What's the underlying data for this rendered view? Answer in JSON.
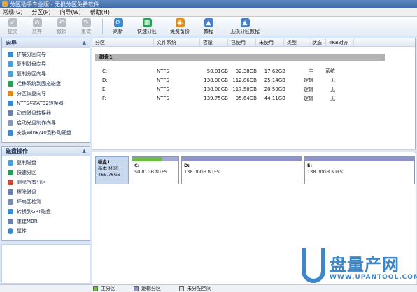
{
  "window": {
    "title": "分区助手专业版 - 无损分区免费软件"
  },
  "menu": [
    "常规(G)",
    "分区(P)",
    "向导(W)",
    "帮助(H)"
  ],
  "toolbar": {
    "commit": "提交",
    "discard": "放弃",
    "undo": "撤销",
    "redo": "重做",
    "refresh": "刷新",
    "quick_partition": "快速分区",
    "free_backup": "免费备份",
    "tutorial": "教程",
    "lossless_tutorial": "无损分区教程"
  },
  "wizard_panel": {
    "title": "向导",
    "items": [
      "扩展分区向导",
      "复制磁盘向导",
      "复制分区向导",
      "迁移系统到固态磁盘",
      "分区恢复向导",
      "NTFS与FAT32转换器",
      "动态磁盘转换器",
      "启动光盘制作向导",
      "安装Win8/10到移动硬盘"
    ]
  },
  "disk_ops_panel": {
    "title": "磁盘操作",
    "items": [
      "复制磁盘",
      "快速分区",
      "删除所有分区",
      "擦除磁盘",
      "坏扇区检测",
      "转换到GPT磁盘",
      "重建MBR",
      "属性"
    ]
  },
  "grid": {
    "columns": [
      "分区",
      "文件系统",
      "容量",
      "已使用",
      "未使用",
      "类型",
      "状态",
      "4KB对齐"
    ],
    "disk_label": "磁盘1",
    "rows": [
      {
        "part": "C:",
        "fs": "NTFS",
        "cap": "50.01GB",
        "used": "32.38GB",
        "free": "17.62GB",
        "type": "主",
        "status": "系统"
      },
      {
        "part": "D:",
        "fs": "NTFS",
        "cap": "138.00GB",
        "used": "112.86GB",
        "free": "25.14GB",
        "type": "逻辑",
        "status": "无"
      },
      {
        "part": "E:",
        "fs": "NTFS",
        "cap": "138.00GB",
        "used": "117.50GB",
        "free": "20.50GB",
        "type": "逻辑",
        "status": "无"
      },
      {
        "part": "F:",
        "fs": "NTFS",
        "cap": "139.75GB",
        "used": "95.64GB",
        "free": "44.11GB",
        "type": "逻辑",
        "status": "无"
      }
    ]
  },
  "disk_map": {
    "disk": {
      "name": "磁盘1",
      "type": "基本 MBR",
      "size": "465.76GB"
    },
    "partitions": [
      {
        "name": "C:",
        "size": "50.01GB NTFS",
        "used_fraction": 0.647
      },
      {
        "name": "D:",
        "size": "138.00GB NTFS",
        "used_fraction": 0.818
      },
      {
        "name": "E:",
        "size": "138.00GB NTFS",
        "used_fraction": 0.851
      }
    ]
  },
  "legend": [
    "主分区",
    "逻辑分区",
    "未分配空间"
  ],
  "watermark": {
    "brand": "盘量产网",
    "url": "WWW.UPANTOOL.COM"
  },
  "colors": {
    "primary": "#6abf3d",
    "logical": "#8f93c9",
    "unallocated": "#e0e0e0",
    "brand": "#3d86c9"
  }
}
